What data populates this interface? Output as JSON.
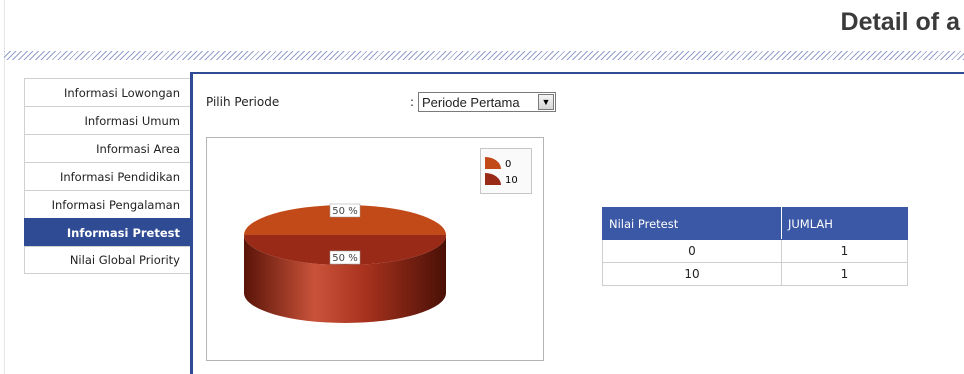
{
  "page": {
    "title": "Detail of a"
  },
  "sidebar": {
    "items": [
      {
        "label": "Informasi Lowongan",
        "active": false
      },
      {
        "label": "Informasi Umum",
        "active": false
      },
      {
        "label": "Informasi Area",
        "active": false
      },
      {
        "label": "Informasi Pendidikan",
        "active": false
      },
      {
        "label": "Informasi Pengalaman",
        "active": false
      },
      {
        "label": "Informasi Pretest",
        "active": true
      },
      {
        "label": "Nilai Global Priority",
        "active": false
      }
    ]
  },
  "periode": {
    "label": "Pilih Periode",
    "colon": ":",
    "selected": "Periode Pertama",
    "arrow": "▼"
  },
  "colors": {
    "accent": "#2f4b94",
    "slice_0": "#c24a18",
    "slice_10": "#9a2a18"
  },
  "chart_data": {
    "type": "pie",
    "categories": [
      "0",
      "10"
    ],
    "values": [
      1,
      1
    ],
    "data_labels": [
      "50 %",
      "50 %"
    ],
    "legend": [
      "0",
      "10"
    ],
    "legend_position": "top-right",
    "style": "3d"
  },
  "table": {
    "headers": [
      "Nilai Pretest",
      "JUMLAH"
    ],
    "rows": [
      [
        "0",
        "1"
      ],
      [
        "10",
        "1"
      ]
    ]
  }
}
